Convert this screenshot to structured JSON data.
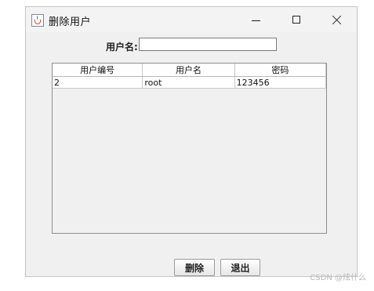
{
  "window": {
    "title": "删除用户",
    "controls": {
      "minimize": "minimize-icon",
      "maximize": "maximize-icon",
      "close": "close-icon"
    }
  },
  "form": {
    "username_label": "用户名:",
    "username_value": ""
  },
  "table": {
    "headers": [
      "用户编号",
      "用户名",
      "密码"
    ],
    "rows": [
      [
        "2",
        "root",
        "123456"
      ]
    ]
  },
  "buttons": {
    "delete_label": "删除",
    "exit_label": "退出"
  },
  "watermark": "CSDN @炫什么"
}
